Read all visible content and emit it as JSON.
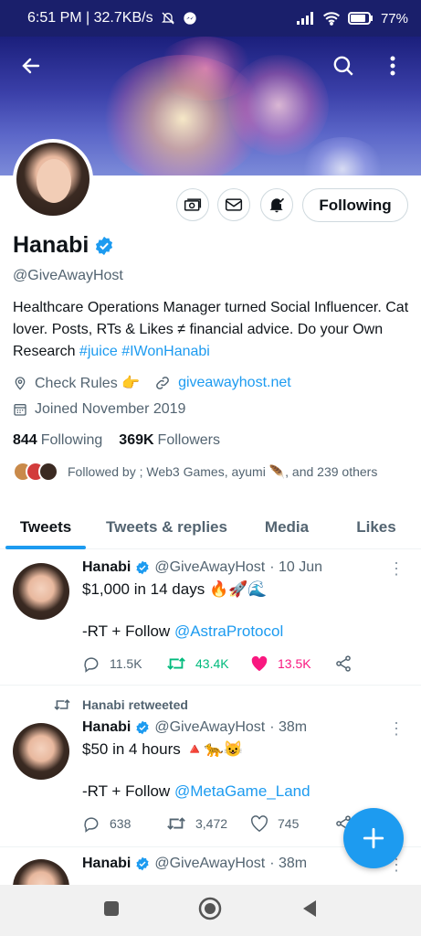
{
  "status_bar": {
    "time_speed": "6:51 PM | 32.7KB/s",
    "battery": "77%"
  },
  "profile": {
    "name": "Hanabi",
    "handle": "@GiveAwayHost",
    "bio_text": "Healthcare Operations Manager turned Social Influencer. Cat lover. Posts, RTs & Likes ≠ financial advice. Do your Own Research ",
    "bio_hashtag1": "#juice",
    "bio_hashtag2": "#IWonHanabi",
    "location": "Check Rules 👉",
    "website": "giveawayhost.net",
    "joined": "Joined November 2019",
    "following_count": "844",
    "following_label": "Following",
    "followers_count": "369K",
    "followers_label": "Followers",
    "followed_by": "Followed by ; Web3 Games, ayumi 🪶, and 239 others",
    "following_button": "Following"
  },
  "tabs": [
    {
      "label": "Tweets",
      "active": true
    },
    {
      "label": "Tweets & replies",
      "active": false
    },
    {
      "label": "Media",
      "active": false
    },
    {
      "label": "Likes",
      "active": false
    }
  ],
  "tweets": [
    {
      "name": "Hanabi",
      "handle": "@GiveAwayHost",
      "time": "· 10 Jun",
      "line1": "$1,000 in 14 days 🔥🚀🌊",
      "line2_prefix": "-RT + Follow ",
      "line2_mention": "@AstraProtocol",
      "replies": "11.5K",
      "retweets": "43.4K",
      "likes": "13.5K"
    },
    {
      "retweet_label": "Hanabi retweeted",
      "name": "Hanabi",
      "handle": "@GiveAwayHost",
      "time": "· 38m",
      "line1": "$50 in 4 hours 🔺🐆😺",
      "line2_prefix": "-RT + Follow ",
      "line2_mention": "@MetaGame_Land",
      "replies": "638",
      "retweets": "3,472",
      "likes": "745"
    },
    {
      "name": "Hanabi",
      "handle": "@GiveAwayHost",
      "time": "· 38m"
    }
  ],
  "colors": {
    "accent": "#1d9bf0",
    "retweet_green": "#00ba7c",
    "like_pink": "#f91880"
  }
}
